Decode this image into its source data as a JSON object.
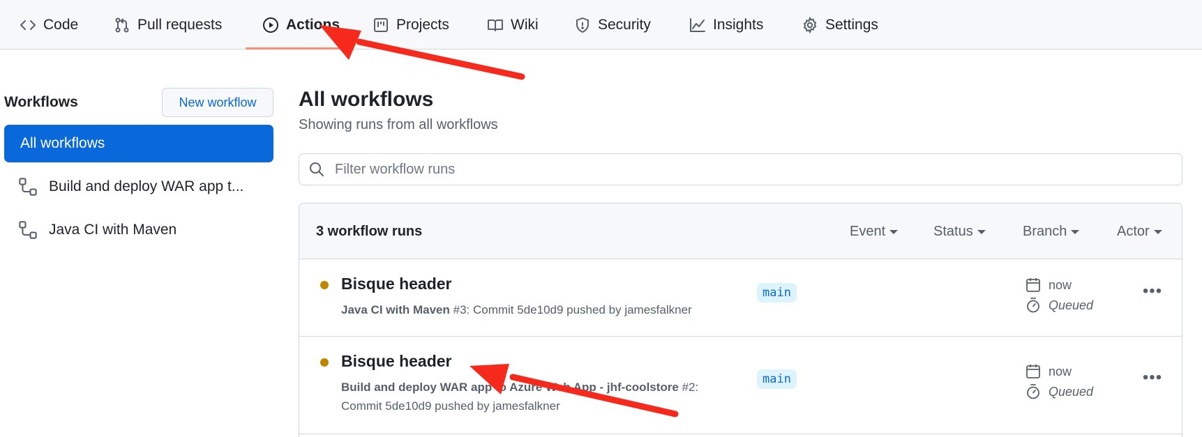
{
  "nav": {
    "tabs": [
      {
        "label": "Code",
        "icon": "code-icon"
      },
      {
        "label": "Pull requests",
        "icon": "pull-request-icon"
      },
      {
        "label": "Actions",
        "icon": "play-icon"
      },
      {
        "label": "Projects",
        "icon": "project-icon"
      },
      {
        "label": "Wiki",
        "icon": "book-icon"
      },
      {
        "label": "Security",
        "icon": "shield-icon"
      },
      {
        "label": "Insights",
        "icon": "graph-icon"
      },
      {
        "label": "Settings",
        "icon": "gear-icon"
      }
    ],
    "active_tab": "Actions",
    "underline_color": "#fd8c73"
  },
  "sidebar": {
    "title": "Workflows",
    "new_button": "New workflow",
    "items": [
      {
        "label": "All workflows"
      },
      {
        "label": "Build and deploy WAR app t..."
      },
      {
        "label": "Java CI with Maven"
      }
    ],
    "selected_color": "#0969da"
  },
  "main": {
    "title": "All workflows",
    "subtitle": "Showing runs from all workflows",
    "filter_placeholder": "Filter workflow runs",
    "runs_count": "3 workflow runs",
    "filters": [
      "Event",
      "Status",
      "Branch",
      "Actor"
    ],
    "runs": [
      {
        "title": "Bisque header",
        "workflow": "Java CI with Maven",
        "meta_line1_rest": " #3: Commit 5de10d9 pushed by jamesfalkner",
        "meta_line2": "",
        "branch": "main",
        "time": "now",
        "status": "Queued"
      },
      {
        "title": "Bisque header",
        "workflow": "Build and deploy WAR app to Azure Web App - jhf-coolstore",
        "meta_line1_rest": " #2:",
        "meta_line2": "Commit 5de10d9 pushed by jamesfalkner",
        "branch": "main",
        "time": "now",
        "status": "Queued"
      }
    ],
    "status_color": "#bf8700"
  },
  "annotation": {
    "arrow_color": "#f52a1c"
  }
}
